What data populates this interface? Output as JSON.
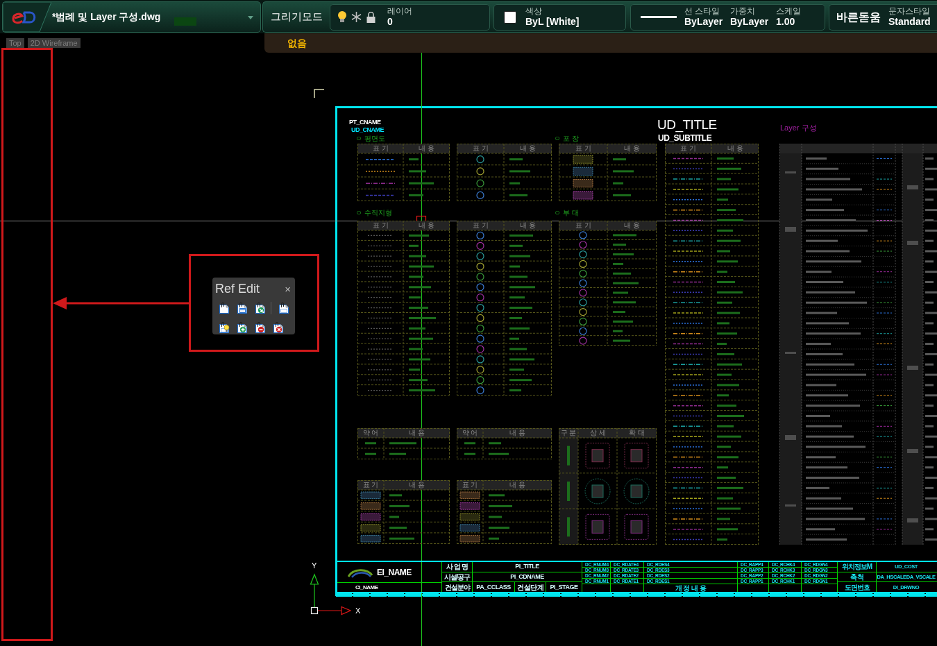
{
  "file_tab": {
    "title": "*범례 및 Layer 구성.dwg"
  },
  "toolbar": {
    "mode": "그리기모드",
    "layer": {
      "label": "레이어",
      "value": "0",
      "on": true
    },
    "color": {
      "label": "색상",
      "value": "ByL [White]"
    },
    "linetype": {
      "label": "선 스타일",
      "value": "ByLayer"
    },
    "lineweight": {
      "label": "가중치",
      "value": "ByLayer"
    },
    "scale": {
      "label": "스케일",
      "value": "1.00"
    },
    "font": "바른돋움",
    "text_style": {
      "label": "문자스타일",
      "value": "Standard"
    }
  },
  "command_bar": {
    "text": "없음"
  },
  "viewport": {
    "view_labels": [
      "Top",
      "2D Wireframe"
    ]
  },
  "ref_edit": {
    "title": "Ref Edit",
    "close": "×"
  },
  "sheet": {
    "project_name": "PT_CNAME",
    "company_name": "UD_CNAME",
    "title": "UD_TITLE",
    "subtitle": "UD_SUBTITLE",
    "layer_heading": "Layer 구성",
    "sections": [
      {
        "heading": "ㅇ 평면도",
        "tables": [
          {
            "headers": [
              "표 기",
              "내 용"
            ]
          },
          {
            "headers": [
              "표 기",
              "내 용"
            ]
          }
        ]
      },
      {
        "heading": "ㅇ 포 장",
        "tables": [
          {
            "headers": [
              "표 기",
              "내 용"
            ]
          }
        ]
      },
      {
        "tables": [
          {
            "headers": [
              "표 기",
              "내 용"
            ]
          }
        ]
      },
      {
        "heading": "ㅇ 수직지형",
        "tables": [
          {
            "headers": [
              "표 기",
              "내 용"
            ]
          },
          {
            "headers": [
              "표 기",
              "내 용"
            ]
          }
        ]
      },
      {
        "heading": "ㅇ 부 대",
        "tables": [
          {
            "headers": [
              "표 기",
              "내 용"
            ]
          }
        ]
      },
      {
        "tables": [
          {
            "headers": [
              "약 어",
              "내 용"
            ]
          },
          {
            "headers": [
              "약 어",
              "내 용"
            ]
          }
        ]
      },
      {
        "tables": [
          {
            "headers": [
              "표 기",
              "내 용"
            ]
          },
          {
            "headers": [
              "표 기",
              "내 용"
            ]
          }
        ]
      },
      {
        "tables": [
          {
            "headers": [
              "구 분",
              "상 세",
              "확 대"
            ]
          }
        ]
      }
    ]
  },
  "title_block": {
    "agency": "EI_NAME",
    "client": "CI_NAME",
    "project_rows": [
      {
        "label": "사 업 명",
        "value": "PI_TITLE"
      },
      {
        "label": "시설/공구",
        "value": "PI_CDNAME"
      },
      {
        "label": "건설분야",
        "values": [
          "PA_CCLASS",
          "건설단계",
          "PI_STAGE"
        ]
      }
    ],
    "revisions": [
      [
        "DC_RNUM4",
        "DC_RDATE4",
        "DC_RDES4",
        "DC_RAPP4",
        "DC_RCHK4",
        "DC_RDGN4"
      ],
      [
        "DC_RNUM3",
        "DC_RDATE3",
        "DC_RDES3",
        "DC_RAPP3",
        "DC_RCHK3",
        "DC_RDGN3"
      ],
      [
        "DC_RNUM2",
        "DC_RDATE2",
        "DC_RDES2",
        "DC_RAPP2",
        "DC_RCHK2",
        "DC_RDGN2"
      ],
      [
        "DC_RNUM1",
        "DC_RDATE1",
        "DC_RDES1",
        "DC_RAPP1",
        "DC_RCHK1",
        "DC_RDGN1"
      ]
    ],
    "revision_header": "개 정 내 용",
    "info_rows": [
      {
        "label": "위치정보M",
        "value": "UD_COST"
      },
      {
        "label": "축 척",
        "value": "DA_HSCALEDA_VSCALE"
      },
      {
        "label": "도면번호",
        "value": "DI_DRWNO"
      }
    ]
  },
  "ucs": {
    "y": "Y",
    "x": "X"
  }
}
